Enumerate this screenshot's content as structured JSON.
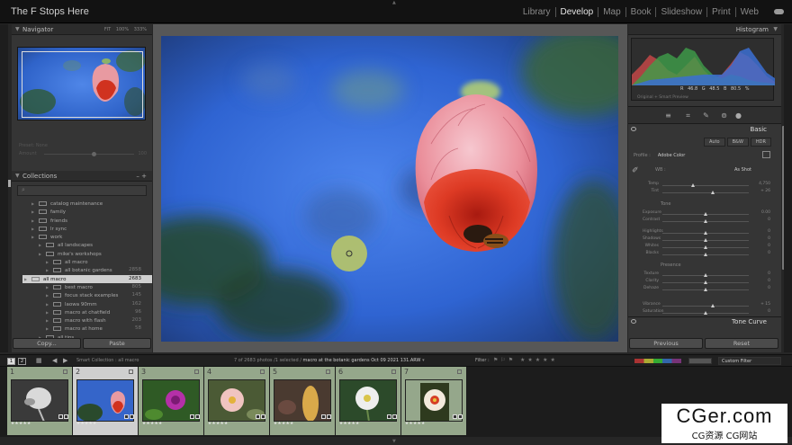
{
  "app": {
    "title": "The F Stops Here",
    "modules": [
      "Library",
      "Develop",
      "Map",
      "Book",
      "Slideshow",
      "Print",
      "Web"
    ],
    "active_module": "Develop"
  },
  "navigator": {
    "title": "Navigator",
    "zooms": [
      "FIT",
      "100%",
      "333%"
    ]
  },
  "navfade": {
    "preset_label": "Preset: None",
    "amount_label": "Amount",
    "amount_value": "100"
  },
  "collections": {
    "title": "Collections",
    "search_placeholder": "",
    "items": [
      {
        "label": "catalog maintenance",
        "count": "",
        "level": "lvl1"
      },
      {
        "label": "family",
        "count": "",
        "level": "lvl1"
      },
      {
        "label": "friends",
        "count": "",
        "level": "lvl1"
      },
      {
        "label": "lr sync",
        "count": "",
        "level": "lvl1"
      },
      {
        "label": "work",
        "count": "",
        "level": "lvl1"
      },
      {
        "label": "all landscapes",
        "count": "",
        "level": "lvl2"
      },
      {
        "label": "mike's workshops",
        "count": "",
        "level": "lvl2"
      },
      {
        "label": "all macro",
        "count": "",
        "level": "lvl3"
      },
      {
        "label": "all botanic gardens",
        "count": "2858",
        "level": "lvl3"
      },
      {
        "label": "all macro",
        "count": "2683",
        "level": "lvl3",
        "selected": true
      },
      {
        "label": "best macro",
        "count": "805",
        "level": "lvl3"
      },
      {
        "label": "focus stack examples",
        "count": "145",
        "level": "lvl3"
      },
      {
        "label": "laowa 90mm",
        "count": "162",
        "level": "lvl3"
      },
      {
        "label": "macro at chatfield",
        "count": "96",
        "level": "lvl3"
      },
      {
        "label": "macro with flash",
        "count": "203",
        "level": "lvl3"
      },
      {
        "label": "macro at home",
        "count": "58",
        "level": "lvl3"
      },
      {
        "label": "all tips",
        "count": "",
        "level": "lvl2"
      }
    ]
  },
  "left_buttons": {
    "copy": "Copy...",
    "paste": "Paste"
  },
  "histogram": {
    "title": "Histogram",
    "info": "R 46.8  G 48.5  B 80.5 %",
    "original": "Original + Smart Preview"
  },
  "basic": {
    "title": "Basic",
    "treatment": [
      "Auto",
      "B&W",
      "HDR"
    ],
    "profile_label": "Profile :",
    "profile_value": "Adobe Color",
    "wb_label": "WB :",
    "wb_value": "As Shot",
    "sliders": [
      {
        "label": "Temp",
        "value": "4,750",
        "pos": 0.35
      },
      {
        "label": "Tint",
        "value": "+ 26",
        "pos": 0.58
      },
      {
        "label": "Exposure",
        "value": "0.00",
        "pos": 0.5
      },
      {
        "label": "Contrast",
        "value": "0",
        "pos": 0.5
      },
      {
        "label": "Highlights",
        "value": "0",
        "pos": 0.5
      },
      {
        "label": "Shadows",
        "value": "0",
        "pos": 0.5
      },
      {
        "label": "Whites",
        "value": "0",
        "pos": 0.5
      },
      {
        "label": "Blacks",
        "value": "0",
        "pos": 0.5
      },
      {
        "label": "Texture",
        "value": "0",
        "pos": 0.5
      },
      {
        "label": "Clarity",
        "value": "0",
        "pos": 0.5
      },
      {
        "label": "Dehaze",
        "value": "0",
        "pos": 0.5
      },
      {
        "label": "Vibrance",
        "value": "+ 15",
        "pos": 0.58
      },
      {
        "label": "Saturation",
        "value": "0",
        "pos": 0.5
      }
    ],
    "tone_label": "Tone",
    "presence_label": "Presence"
  },
  "tone_curve": {
    "title": "Tone Curve"
  },
  "right_buttons": {
    "previous": "Previous",
    "reset": "Reset"
  },
  "filmstrip_header": {
    "source": "Smart Collection : all macro",
    "info": "7 of 2683 photos /1 selected /",
    "filename": "macro at the botanic gardens Oct 09 2021 131.ARW",
    "filter_label": "Filter :",
    "custom_filter": "Custom Filter"
  },
  "filmstrip": {
    "cells": [
      {
        "num": "1",
        "stars": "★★★★★",
        "selected": false
      },
      {
        "num": "2",
        "stars": "★★★★★",
        "selected": true
      },
      {
        "num": "3",
        "stars": "★★★★★",
        "selected": false
      },
      {
        "num": "4",
        "stars": "★★★★★",
        "selected": false
      },
      {
        "num": "5",
        "stars": "★★★★★",
        "selected": false
      },
      {
        "num": "6",
        "stars": "★★★★★",
        "selected": false
      },
      {
        "num": "7",
        "stars": "★★★★★",
        "selected": false
      }
    ]
  },
  "watermark": {
    "title": "CGer.com",
    "subtitle": "CG资源  CG网站"
  }
}
